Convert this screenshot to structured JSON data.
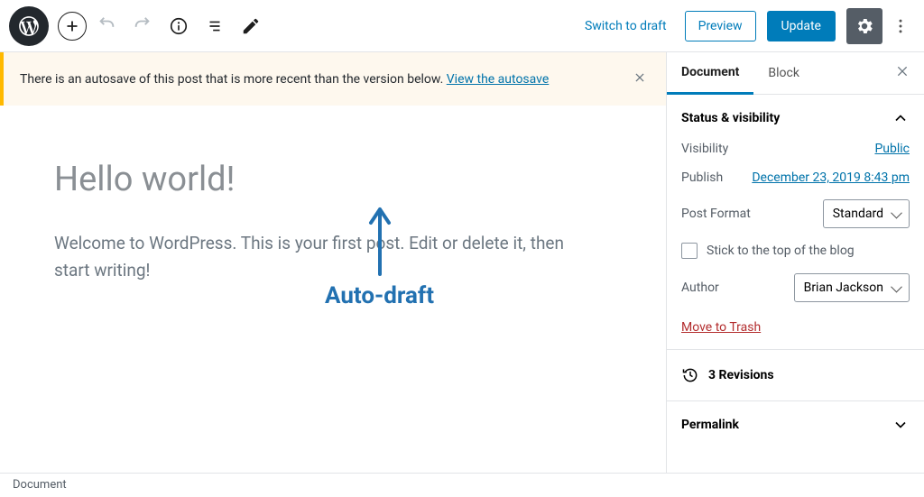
{
  "topbar": {
    "switch_to_draft": "Switch to draft",
    "preview": "Preview",
    "update": "Update"
  },
  "notice": {
    "text": "There is an autosave of this post that is more recent than the version below. ",
    "link": "View the autosave"
  },
  "post": {
    "title": "Hello world!",
    "body": "Welcome to WordPress. This is your first post. Edit or delete it, then start writing!"
  },
  "annotation": "Auto-draft",
  "sidebar": {
    "tabs": {
      "document": "Document",
      "block": "Block"
    },
    "panels": {
      "status": {
        "title": "Status & visibility",
        "visibility_label": "Visibility",
        "visibility_value": "Public",
        "publish_label": "Publish",
        "publish_value": "December 23, 2019 8:43 pm",
        "format_label": "Post Format",
        "format_value": "Standard",
        "stick_label": "Stick to the top of the blog",
        "author_label": "Author",
        "author_value": "Brian Jackson",
        "trash": "Move to Trash"
      },
      "revisions": "3 Revisions",
      "permalink": "Permalink"
    }
  },
  "footer": {
    "breadcrumb": "Document"
  }
}
